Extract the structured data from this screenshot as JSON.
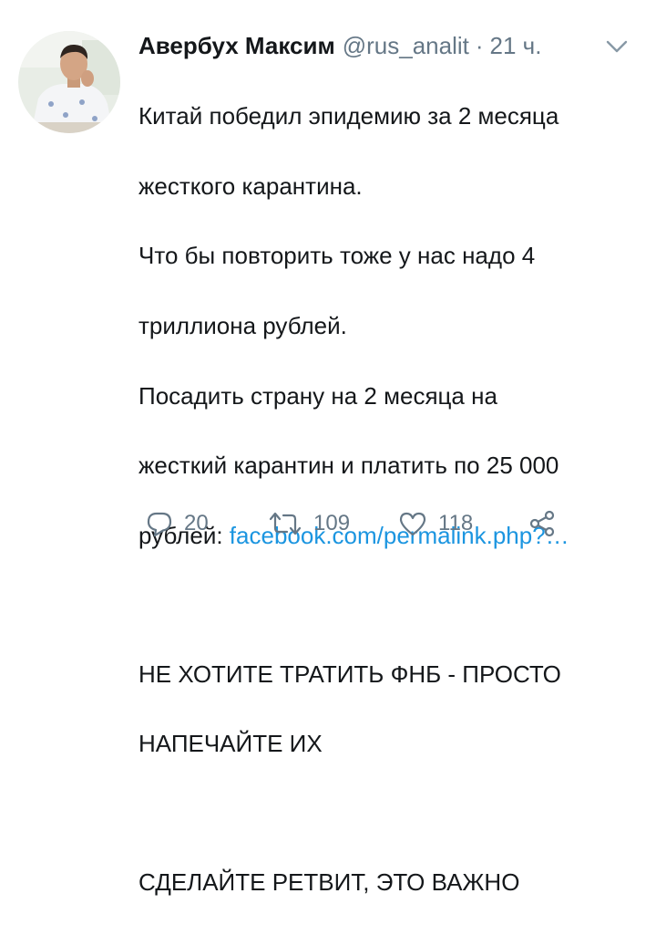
{
  "tweet": {
    "author_name": "Авербух Максим",
    "handle": "@rus_analit",
    "separator": "·",
    "time": "21 ч.",
    "text_lines": [
      "Китай победил эпидемию за 2 месяца",
      "жесткого карантина.",
      "Что бы повторить тоже у нас надо 4",
      "триллиона рублей.",
      "Посадить страну на 2 месяца на",
      "жесткий карантин и платить по 25 000"
    ],
    "last_line_prefix": "рублей: ",
    "link_text": "facebook.com/permalink.php?…",
    "caps_line_1": "НЕ ХОТИТЕ ТРАТИТЬ ФНБ - ПРОСТО",
    "caps_line_2": "НАПЕЧАЙТЕ ИХ",
    "caps_line_3": "СДЕЛАЙТЕ РЕТВИТ, ЭТО ВАЖНО"
  },
  "actions": {
    "reply_count": "20",
    "retweet_count": "109",
    "like_count": "118"
  },
  "icons": {
    "reply": "reply-icon",
    "retweet": "retweet-icon",
    "like": "heart-icon",
    "share": "share-icon",
    "caret": "chevron-down-icon"
  },
  "colors": {
    "text": "#14171a",
    "secondary": "#657786",
    "link": "#1b95e0"
  }
}
